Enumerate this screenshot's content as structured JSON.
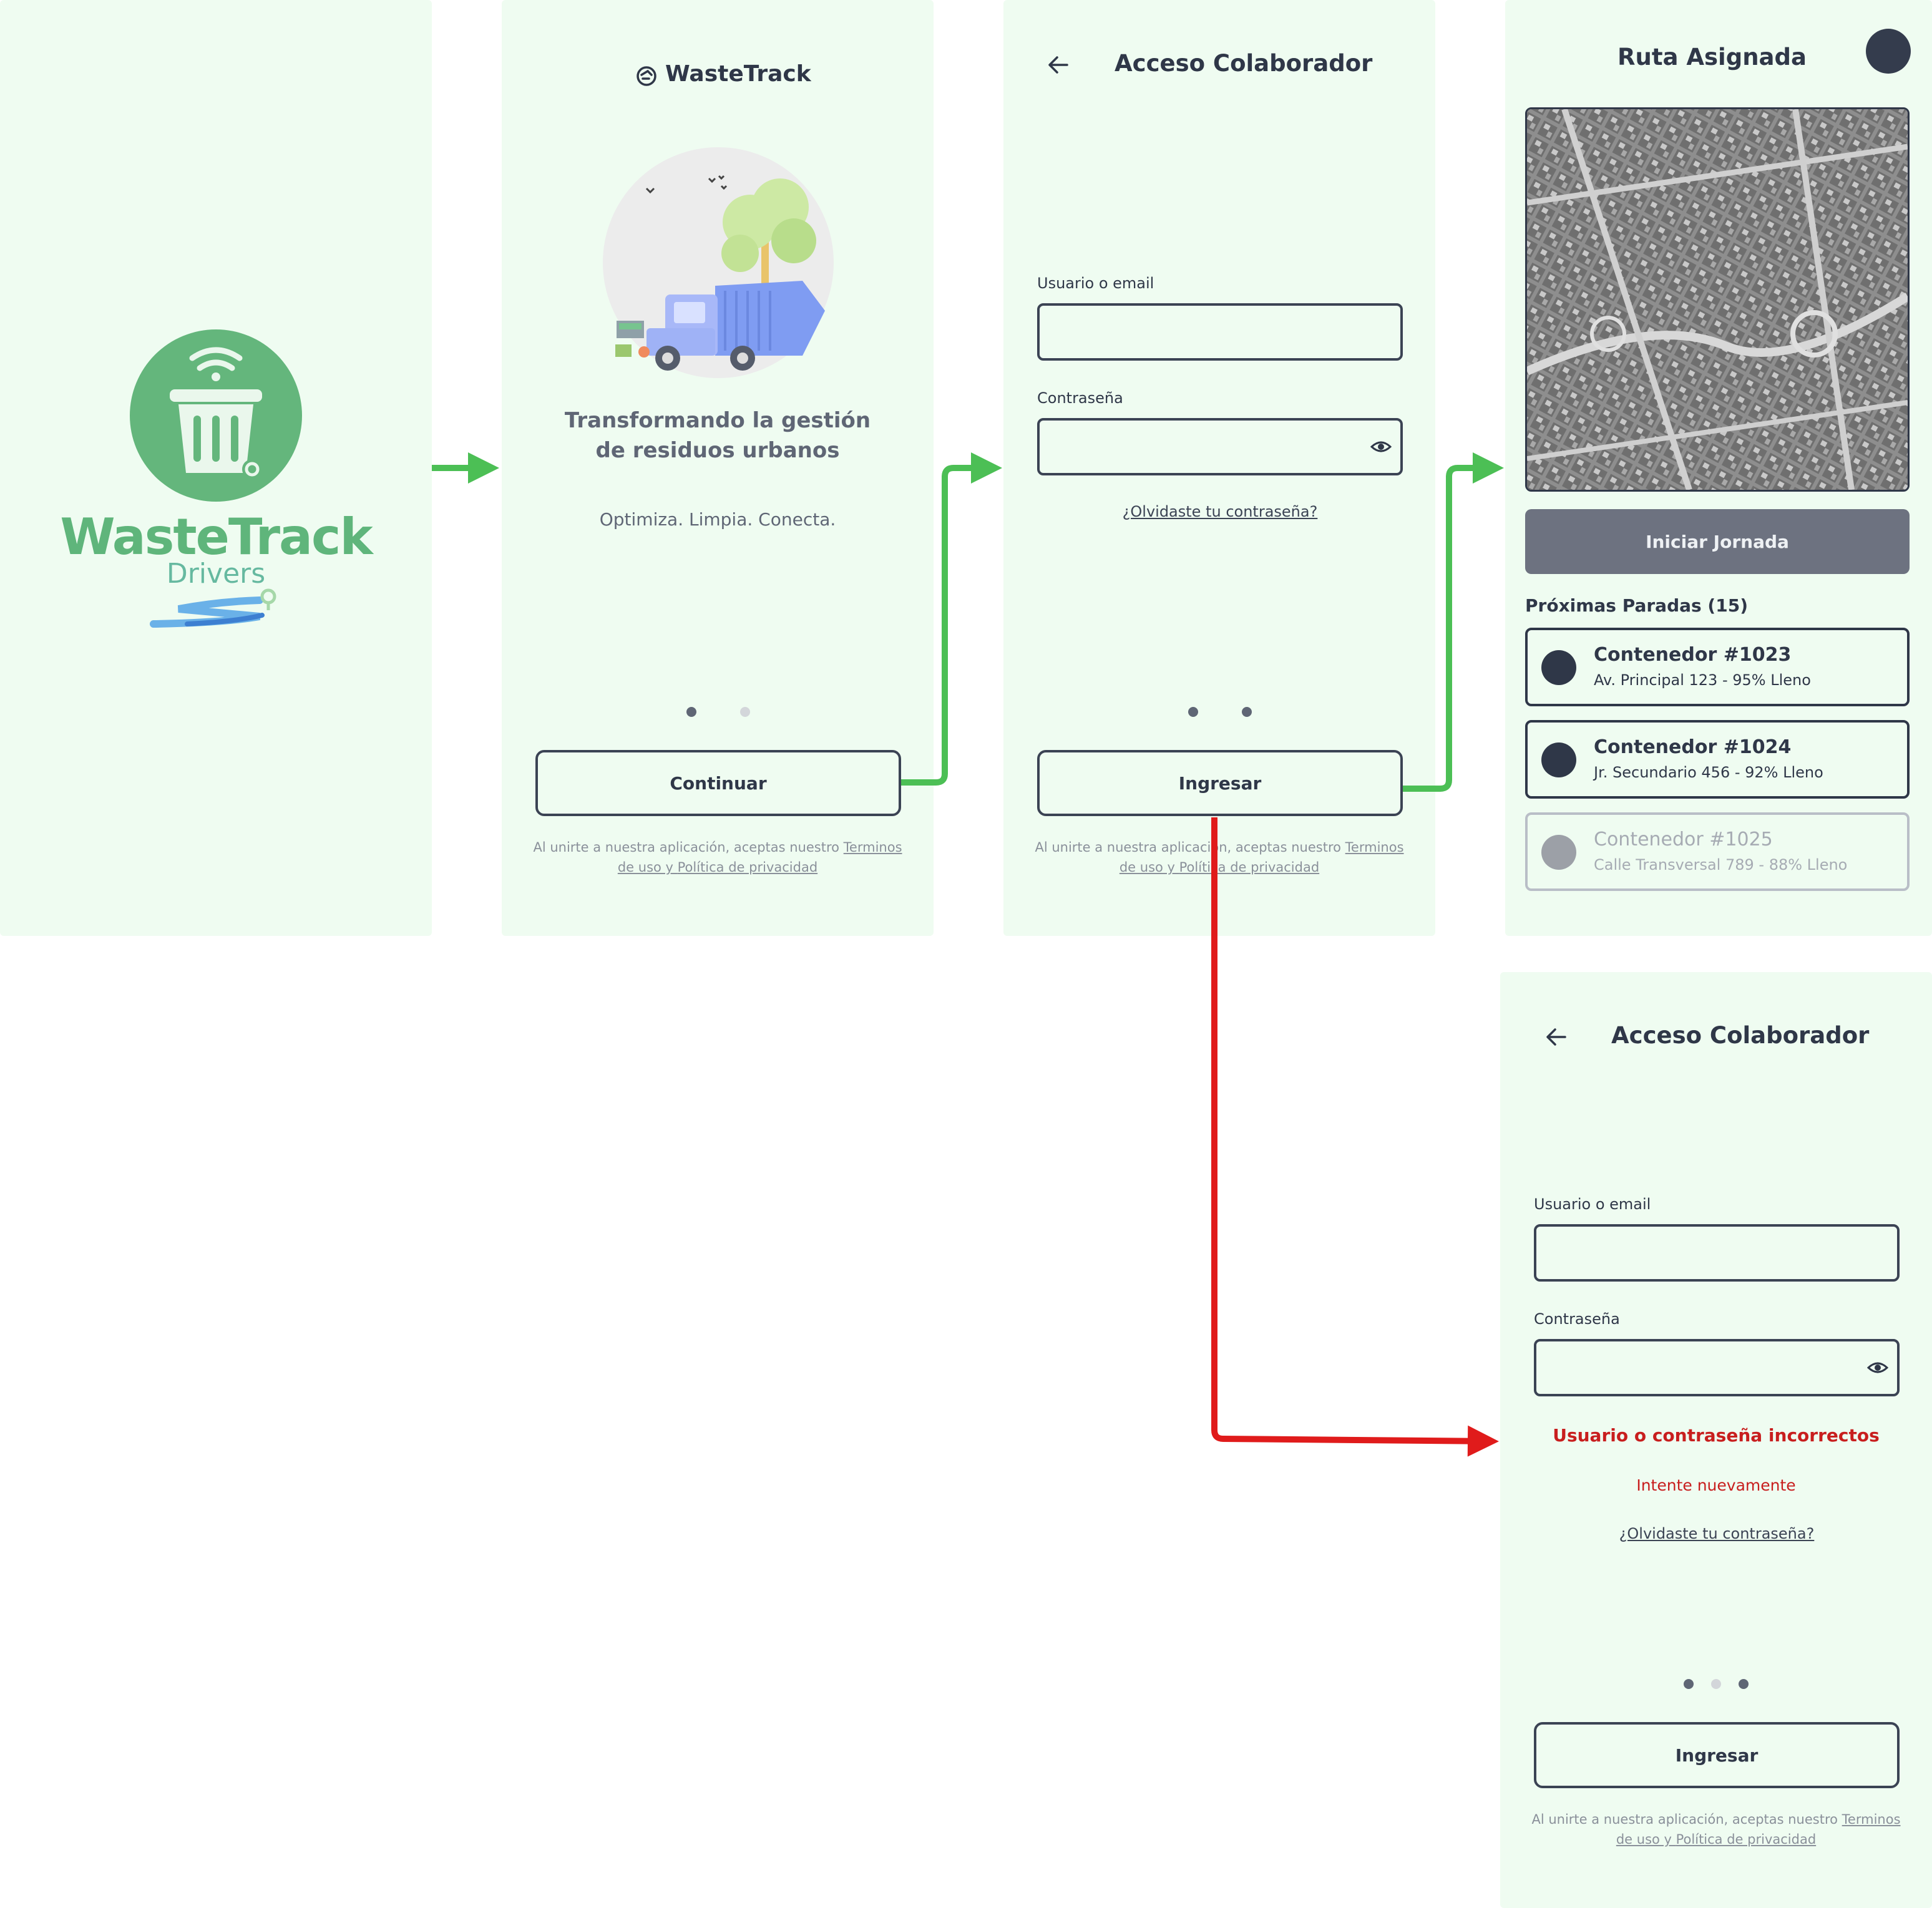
{
  "splash": {
    "brand": "WasteTrack",
    "brand_sub": "Drivers"
  },
  "welcome": {
    "app_name": "WasteTrack",
    "headline_line1": "Transformando la gestión",
    "headline_line2": "de residuos urbanos",
    "tagline": "Optimiza. Limpia. Conecta.",
    "continue_label": "Continuar",
    "legal_prefix": "Al unirte a nuestra aplicación, aceptas nuestro ",
    "legal_terms": "Terminos",
    "legal_mid": "de uso y ",
    "legal_privacy": "Política de privacidad"
  },
  "login": {
    "title": "Acceso Colaborador",
    "user_label": "Usuario o email",
    "password_label": "Contraseña",
    "forgot_label": "¿Olvidaste tu contraseña?",
    "submit_label": "Ingresar",
    "legal_prefix": "Al unirte a nuestra aplicación, aceptas nuestro ",
    "legal_terms": "Terminos",
    "legal_mid": "de uso y ",
    "legal_privacy": "Política de privacidad"
  },
  "route": {
    "title": "Ruta Asignada",
    "start_label": "Iniciar Jornada",
    "stops_header": "Próximas Paradas (15)",
    "stops": [
      {
        "title": "Contenedor #1023",
        "detail": "Av. Principal 123 - 95% Lleno"
      },
      {
        "title": "Contenedor #1024",
        "detail": "Jr. Secundario 456 - 92% Lleno"
      },
      {
        "title": "Contenedor #1025",
        "detail": "Calle Transversal 789 - 88% Lleno"
      }
    ]
  },
  "login_error": {
    "title": "Acceso Colaborador",
    "user_label": "Usuario o email",
    "password_label": "Contraseña",
    "error_main": "Usuario o contraseña incorrectos",
    "error_retry": "Intente nuevamente",
    "forgot_label": "¿Olvidaste tu contraseña?",
    "submit_label": "Ingresar",
    "legal_prefix": "Al unirte a nuestra aplicación, aceptas nuestro ",
    "legal_terms": "Terminos",
    "legal_mid": "de uso y ",
    "legal_privacy": "Política de privacidad"
  },
  "colors": {
    "screen_bg": "#effcf1",
    "success_arrow": "#4cbf55",
    "error_arrow": "#e01b1b",
    "error_text": "#c81e1e",
    "ink": "#2f3748",
    "brand_green": "#5fb57b"
  }
}
